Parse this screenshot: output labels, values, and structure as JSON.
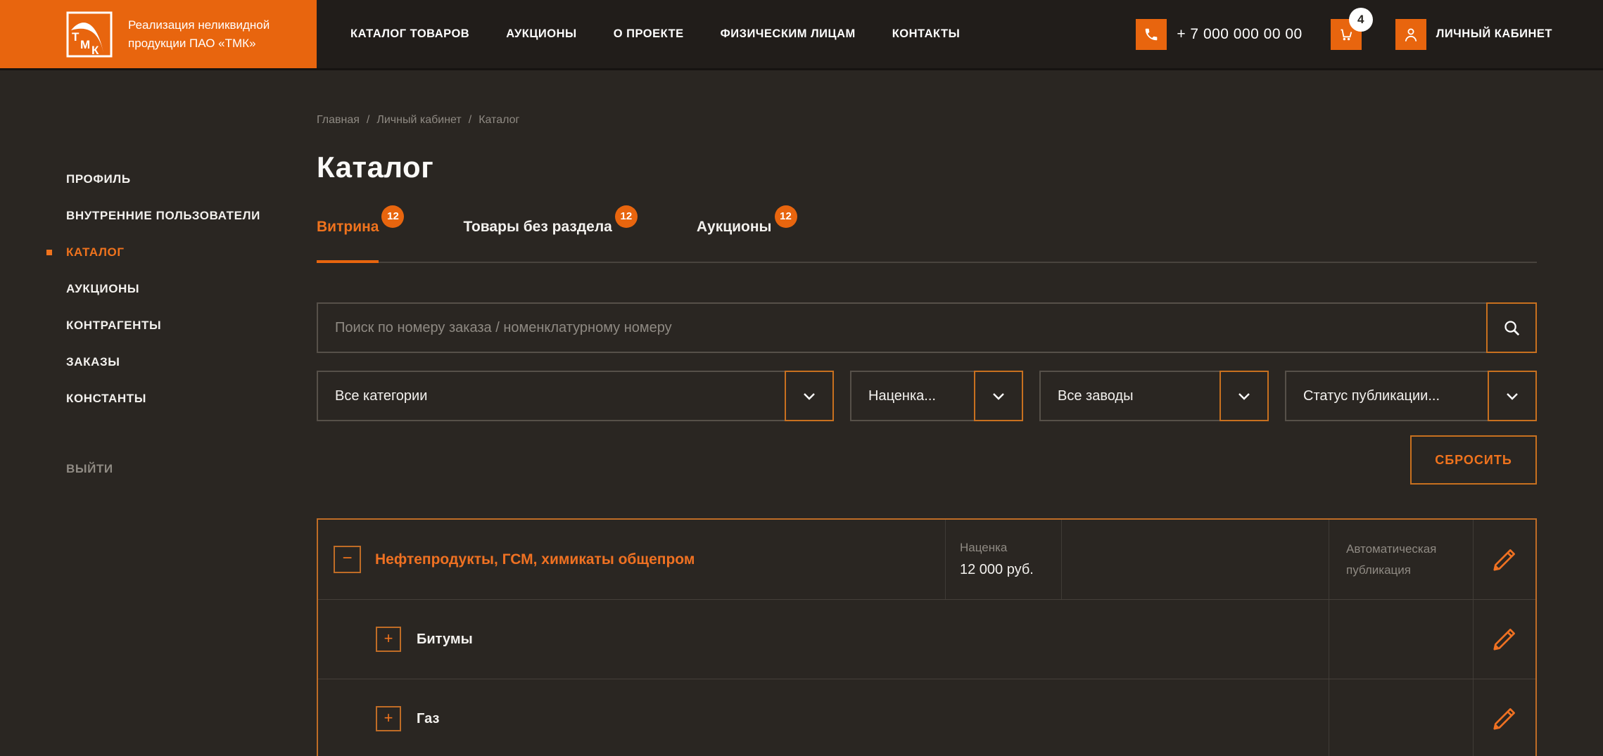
{
  "header": {
    "brand": {
      "logo_text": "ТМК",
      "tagline_line1": "Реализация неликвидной",
      "tagline_line2": "продукции ПАО «ТМК»"
    },
    "nav": [
      {
        "label": "КАТАЛОГ ТОВАРОВ"
      },
      {
        "label": "АУКЦИОНЫ"
      },
      {
        "label": "О ПРОЕКТЕ"
      },
      {
        "label": "ФИЗИЧЕСКИМ ЛИЦАМ"
      },
      {
        "label": "КОНТАКТЫ"
      }
    ],
    "phone": {
      "number": "+ 7 000 000 00 00"
    },
    "cart": {
      "count": "4"
    },
    "account": {
      "label": "ЛИЧНЫЙ КАБИНЕТ"
    }
  },
  "sidebar": {
    "items": [
      {
        "label": "ПРОФИЛЬ",
        "active": false
      },
      {
        "label": "ВНУТРЕННИЕ ПОЛЬЗОВАТЕЛИ",
        "active": false
      },
      {
        "label": "КАТАЛОГ",
        "active": true
      },
      {
        "label": "АУКЦИОНЫ",
        "active": false
      },
      {
        "label": "КОНТРАГЕНТЫ",
        "active": false
      },
      {
        "label": "ЗАКАЗЫ",
        "active": false
      },
      {
        "label": "КОНСТАНТЫ",
        "active": false
      }
    ],
    "logout_label": "ВЫЙТИ"
  },
  "breadcrumb": {
    "separator": "/",
    "items": [
      {
        "label": "Главная"
      },
      {
        "label": "Личный кабинет"
      },
      {
        "label": "Каталог"
      }
    ]
  },
  "page": {
    "title": "Каталог"
  },
  "tabs": [
    {
      "label": "Витрина",
      "badge": "12",
      "active": true
    },
    {
      "label": "Товары без раздела",
      "badge": "12",
      "active": false
    },
    {
      "label": "Аукционы",
      "badge": "12",
      "active": false
    }
  ],
  "search": {
    "placeholder": "Поиск по номеру заказа / номенклатурному номеру",
    "value": ""
  },
  "filters": [
    {
      "value": "Все категории"
    },
    {
      "value": "Наценка..."
    },
    {
      "value": "Все заводы"
    },
    {
      "value": "Статус публикации..."
    }
  ],
  "actions": {
    "reset_label": "СБРОСИТЬ"
  },
  "catalog_table": {
    "rows": [
      {
        "level": "category",
        "toggle": "−",
        "name": "Нефтепродукты, ГСМ, химикаты общепром",
        "markup_label": "Наценка",
        "markup_value": "12 000 руб.",
        "publication_label": "Автоматическая публикация"
      },
      {
        "level": "subcategory",
        "toggle": "+",
        "name": "Битумы"
      },
      {
        "level": "subcategory",
        "toggle": "+",
        "name": "Газ"
      }
    ]
  },
  "colors": {
    "brand_orange": "#e8650e",
    "accent_text": "#f0731d",
    "table_border": "#bf6c26"
  }
}
